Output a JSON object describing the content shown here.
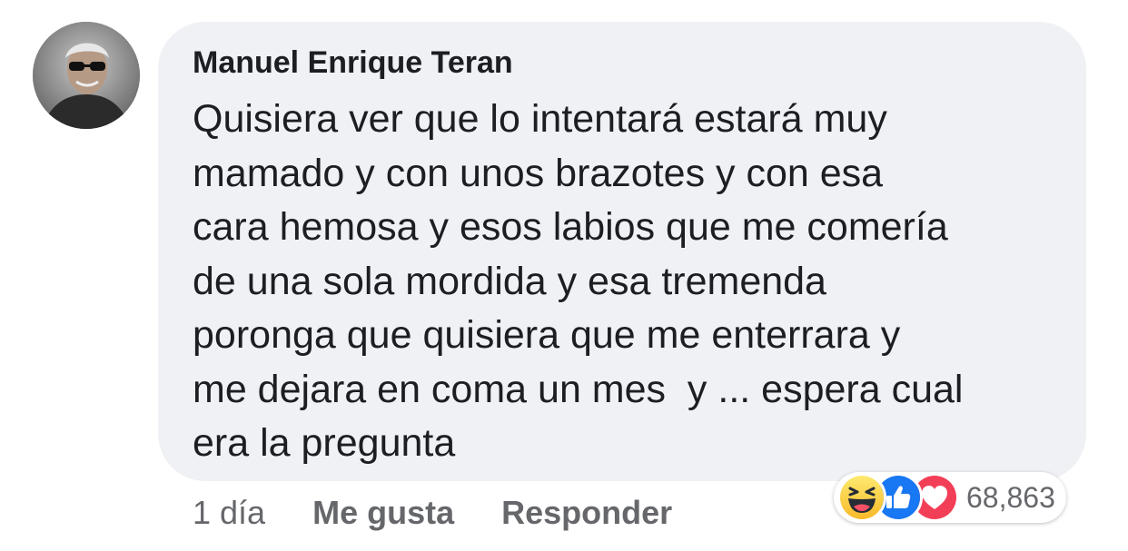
{
  "comment": {
    "author": "Manuel Enrique Teran",
    "text_lines": [
      "Quisiera ver que lo intentará estará muy",
      "mamado y con unos brazotes y con esa",
      "cara hemosa y esos labios que me comería",
      "de una sola mordida y esa tremenda",
      "poronga que quisiera que me enterrara y",
      "me dejara en coma un mes  y ... espera cual",
      "era la pregunta"
    ]
  },
  "actions": {
    "time": "1 día",
    "like_label": "Me gusta",
    "reply_label": "Responder"
  },
  "reactions": {
    "icons": [
      "haha-icon",
      "like-icon",
      "love-icon"
    ],
    "count": "68,863"
  },
  "colors": {
    "bubble": "#f0f1f4",
    "text": "#1c1e21",
    "secondary": "#65676b",
    "like_blue": "#1877f2",
    "love_red": "#f33e58",
    "haha_yellow": "#f7b928"
  }
}
